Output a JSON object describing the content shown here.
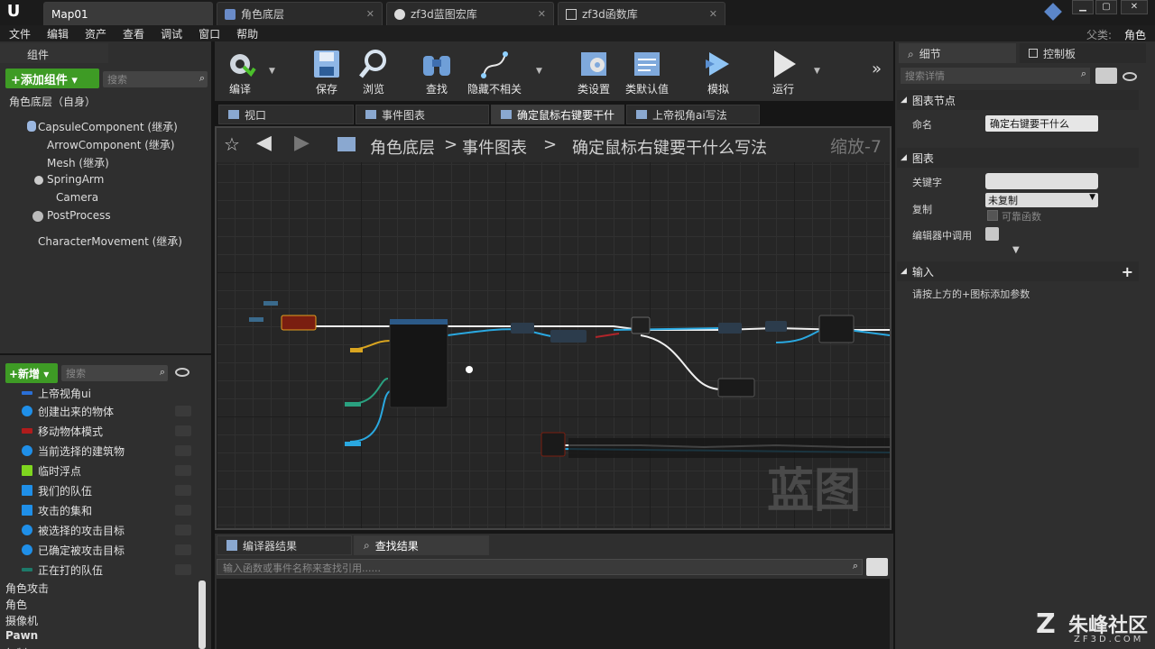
{
  "app": {
    "logo": "U",
    "right_label_1": "父类:",
    "right_label_2": "角色"
  },
  "doc_tabs": [
    {
      "label": "Map01"
    },
    {
      "label": "角色底层"
    },
    {
      "label": "zf3d蓝图宏库"
    },
    {
      "label": "zf3d函数库"
    }
  ],
  "menu": [
    "文件",
    "编辑",
    "资产",
    "查看",
    "调试",
    "窗口",
    "帮助"
  ],
  "components": {
    "tab_label": "组件",
    "add_button": "+添加组件 ▾",
    "search_placeholder": "搜索",
    "root": "角色底层（自身）",
    "items": [
      "CapsuleComponent (继承)",
      "ArrowComponent (继承)",
      "Mesh (继承)",
      "SpringArm",
      "Camera",
      "PostProcess",
      "CharacterMovement (继承)"
    ]
  },
  "toolbar": [
    {
      "label": "编译"
    },
    {
      "label": "保存"
    },
    {
      "label": "浏览"
    },
    {
      "label": "查找"
    },
    {
      "label": "隐藏不相关"
    },
    {
      "label": "类设置"
    },
    {
      "label": "类默认值"
    },
    {
      "label": "模拟"
    },
    {
      "label": "运行"
    }
  ],
  "graph_tabs": [
    "视口",
    "事件图表",
    "确定鼠标右键要干什",
    "上帝视角ai写法"
  ],
  "breadcrumb": {
    "part1": "角色底层",
    "sep": ">",
    "part2": "事件图表",
    "part3": "确定鼠标右键要干什么写法",
    "zoom": "缩放-7"
  },
  "watermark": "蓝图",
  "myblueprint": {
    "new_button": "+新增 ▾",
    "search_placeholder": "搜索",
    "vars": [
      {
        "label": "上帝视角ui",
        "color": "#2a6fd6"
      },
      {
        "label": "创建出来的物体",
        "color": "#1f8fe8"
      },
      {
        "label": "移动物体模式",
        "color": "#b01c1c"
      },
      {
        "label": "当前选择的建筑物",
        "color": "#1f8fe8"
      },
      {
        "label": "临时浮点",
        "color": "#7fd61f"
      },
      {
        "label": "我们的队伍",
        "color": "#1f8fe8"
      },
      {
        "label": "攻击的集和",
        "color": "#1f8fe8"
      },
      {
        "label": "被选择的攻击目标",
        "color": "#1f8fe8"
      },
      {
        "label": "已确定被攻击目标",
        "color": "#1f8fe8"
      },
      {
        "label": "正在打的队伍",
        "color": "#1d7a6a"
      }
    ],
    "categories": [
      "角色攻击",
      "角色",
      "摄像机",
      "Pawn",
      "复制"
    ]
  },
  "bottom": {
    "tab1": "编译器结果",
    "tab2": "查找结果",
    "search_placeholder": "输入函数或事件名称来查找引用......"
  },
  "details": {
    "tab1": "细节",
    "tab2": "控制板",
    "search_placeholder": "搜索详情",
    "section_node": "图表节点",
    "name_label": "命名",
    "name_value": "确定右键要干什么",
    "section_graph": "图表",
    "keyword_label": "关键字",
    "keyword_value": "",
    "replicate_label": "复制",
    "replicate_value": "未复制",
    "reliable_label": "可靠函数",
    "editor_call_label": "编辑器中调用",
    "section_inputs": "输入",
    "inputs_hint": "请按上方的+图标添加参数"
  },
  "brand": {
    "name": "朱峰社区",
    "url": "ZF3D.COM"
  }
}
